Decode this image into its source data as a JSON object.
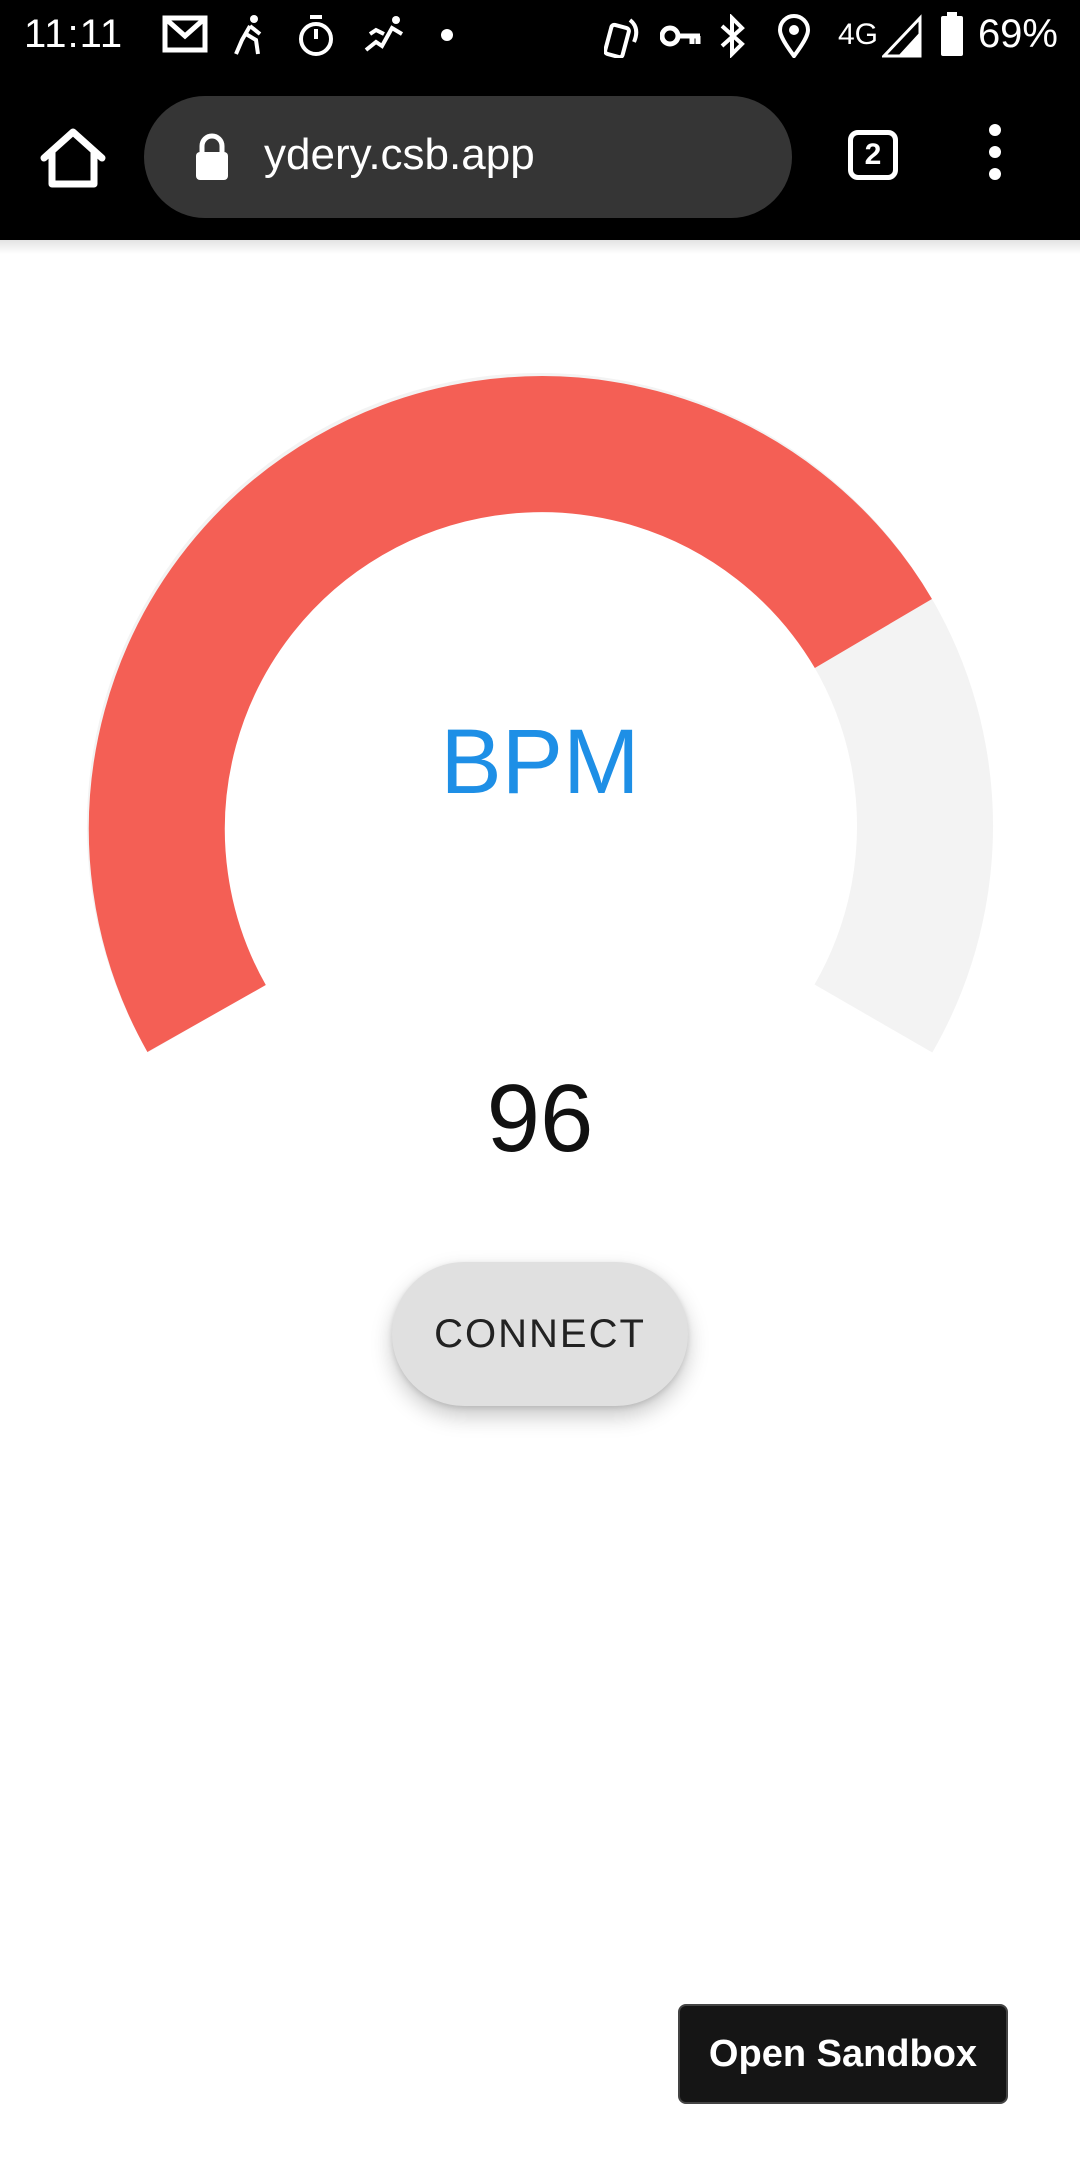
{
  "status_bar": {
    "time": "11:11",
    "network": "4G",
    "battery": "69%",
    "icons": [
      "gmail-icon",
      "runner-icon",
      "stopwatch-icon",
      "sprint-icon",
      "dot-icon",
      "nfc-icon",
      "key-icon",
      "bluetooth-icon",
      "location-icon",
      "signal-icon",
      "battery-icon"
    ]
  },
  "browser": {
    "url": "ydery.csb.app",
    "tab_count": "2"
  },
  "gauge": {
    "label": "BPM",
    "value": "96",
    "fill_fraction": 0.75,
    "fill_color": "#f45f55",
    "track_color": "#f3f3f3",
    "label_color": "#1e8fe6"
  },
  "buttons": {
    "connect": "CONNECT",
    "open_sandbox": "Open Sandbox"
  }
}
